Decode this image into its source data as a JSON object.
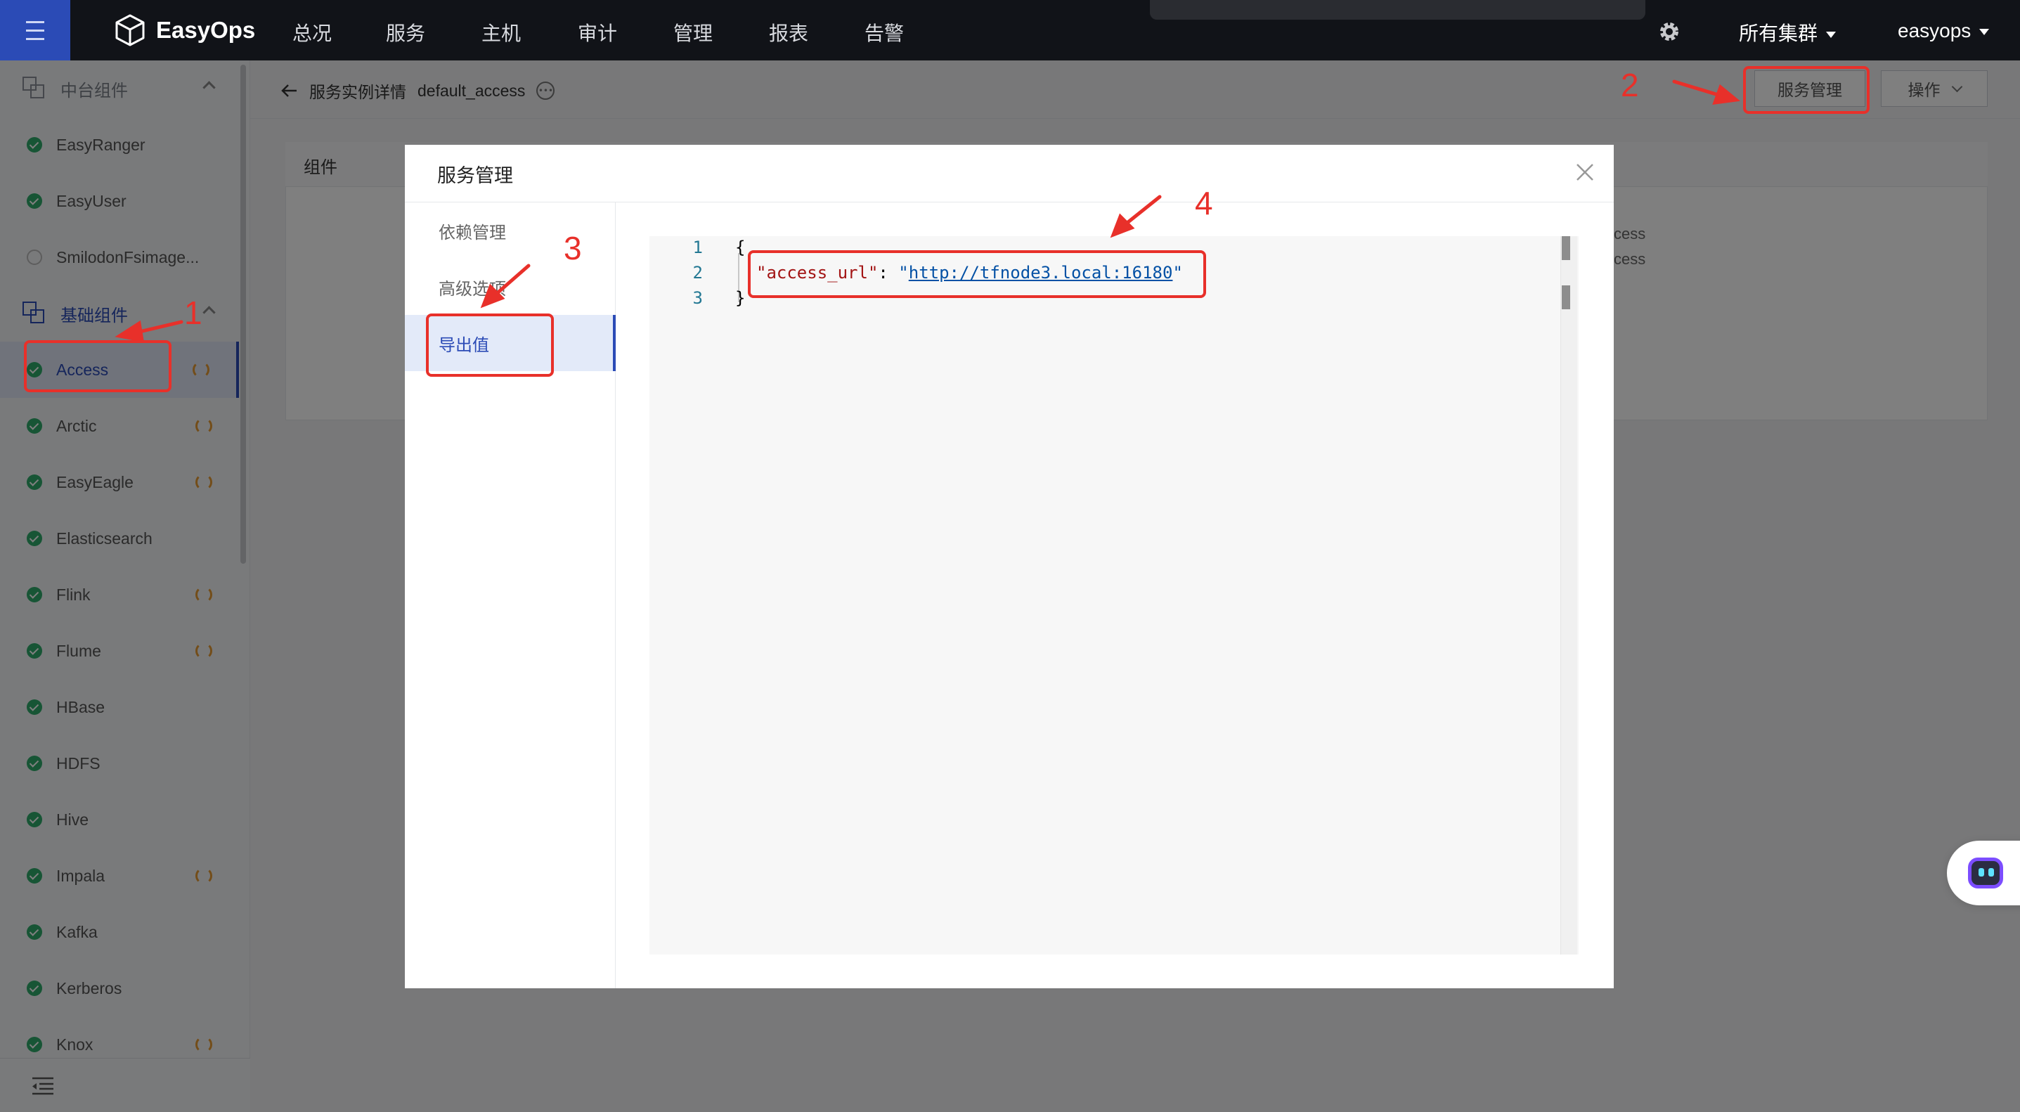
{
  "topnav": {
    "brand": "EasyOps",
    "items": [
      "总况",
      "服务",
      "主机",
      "审计",
      "管理",
      "报表",
      "告警"
    ],
    "cluster": "所有集群",
    "user": "easyops"
  },
  "sidebar": {
    "group1": "中台组件",
    "group2": "基础组件",
    "items_top": [
      "EasyRanger",
      "EasyUser",
      "SmilodonFsimage..."
    ],
    "items": [
      "Access",
      "Arctic",
      "EasyEagle",
      "Elasticsearch",
      "Flink",
      "Flume",
      "HBase",
      "HDFS",
      "Hive",
      "Impala",
      "Kafka",
      "Kerberos",
      "Knox"
    ]
  },
  "breadcrumb": {
    "page": "服务实例详情",
    "instance": "default_access"
  },
  "actions": {
    "service_mgmt": "服务管理",
    "operation": "操作"
  },
  "card": {
    "title": "组件",
    "text1": "cess",
    "text2": "cess"
  },
  "modal": {
    "title": "服务管理",
    "nav": [
      "依赖管理",
      "高级选项",
      "导出值"
    ],
    "code": {
      "line_numbers": [
        "1",
        "2",
        "3"
      ],
      "open": "{",
      "key": "\"access_url\"",
      "colon": ": ",
      "quote_open": "\"",
      "value": "http://tfnode3.local:16180",
      "quote_close": "\"",
      "close": "}"
    }
  },
  "annotations": [
    "1",
    "2",
    "3",
    "4"
  ],
  "colors": {
    "accent": "#2b4bb6",
    "annotation": "#e8302a",
    "ok": "#2eab6b",
    "sync": "#e79b33"
  }
}
